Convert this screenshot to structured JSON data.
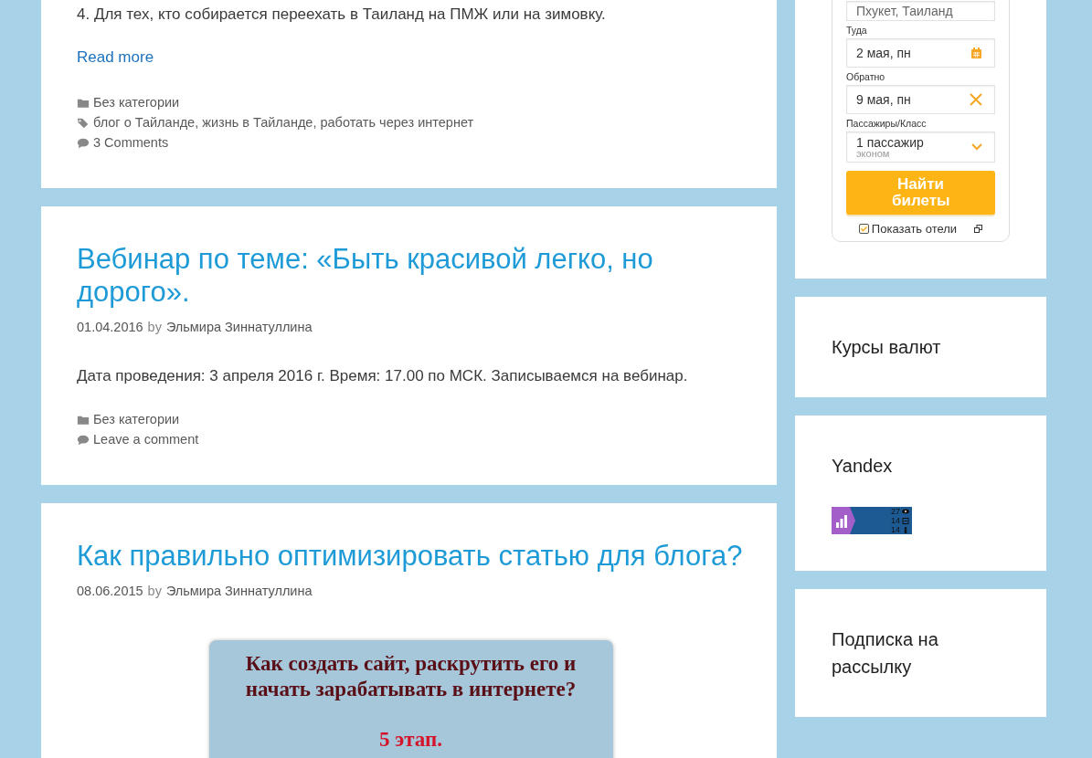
{
  "posts": [
    {
      "excerpt": "4. Для тех, кто собирается переехать в Таиланд на ПМЖ или на зимовку.",
      "read_more": "Read more",
      "categories": "Без категории",
      "tags": [
        "блог о Тайланде",
        "жизнь в Тайланде",
        "работать через интернет"
      ],
      "tag_separator": ",",
      "comments": "3 Comments"
    },
    {
      "title": "Вебинар по теме: «Быть красивой легко, но дорого».",
      "date": "01.04.2016",
      "by": "by",
      "author": "Эльмира Зиннатуллина",
      "excerpt": "Дата проведения: 3 апреля 2016 г. Время: 17.00 по МСК. Записываемся на вебинар.",
      "categories": "Без категории",
      "comments": "Leave a comment"
    },
    {
      "title": "Как правильно оптимизировать статью для блога?",
      "date": "08.06.2015",
      "by": "by",
      "author": "Эльмира Зиннатуллина",
      "banner": {
        "lines": [
          "Как создать сайт, раскрутить его и",
          "начать зарабатывать в интернете?"
        ],
        "stage": "5 этап."
      }
    }
  ],
  "sidebar": {
    "flight_widget": {
      "origin": "Пхукет, Таиланд",
      "fields": [
        {
          "label": "Туда",
          "value": "2 мая, пн",
          "kind": "date"
        },
        {
          "label": "Обратно",
          "value": "9 мая, пн",
          "kind": "clear"
        }
      ],
      "passengers": {
        "label": "Пассажиры/Класс",
        "value": "1 пассажир",
        "travel_class": "эконом"
      },
      "button": "Найти билеты",
      "show_hotels": {
        "label": "Показать отели",
        "checked": true
      }
    },
    "widgets": [
      {
        "title": "Курсы валют"
      },
      {
        "title": "Yandex",
        "counter": {
          "views": "27",
          "visits": "14",
          "visitors": "14"
        }
      },
      {
        "title": "Подписка на рассылку"
      }
    ]
  }
}
